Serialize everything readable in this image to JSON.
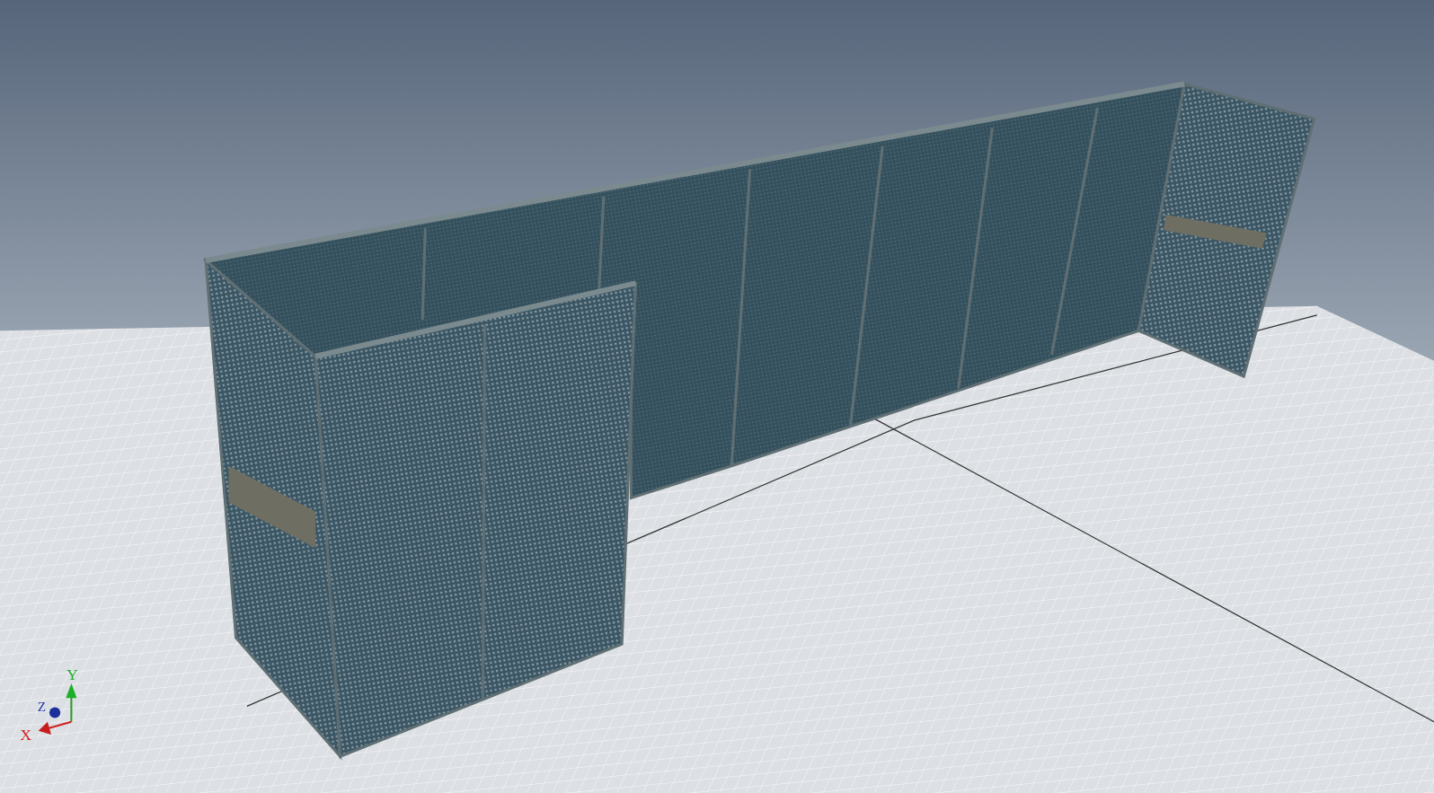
{
  "viewport": {
    "axis_triad": {
      "x_label": "X",
      "y_label": "Y",
      "z_label": "Z"
    }
  }
}
